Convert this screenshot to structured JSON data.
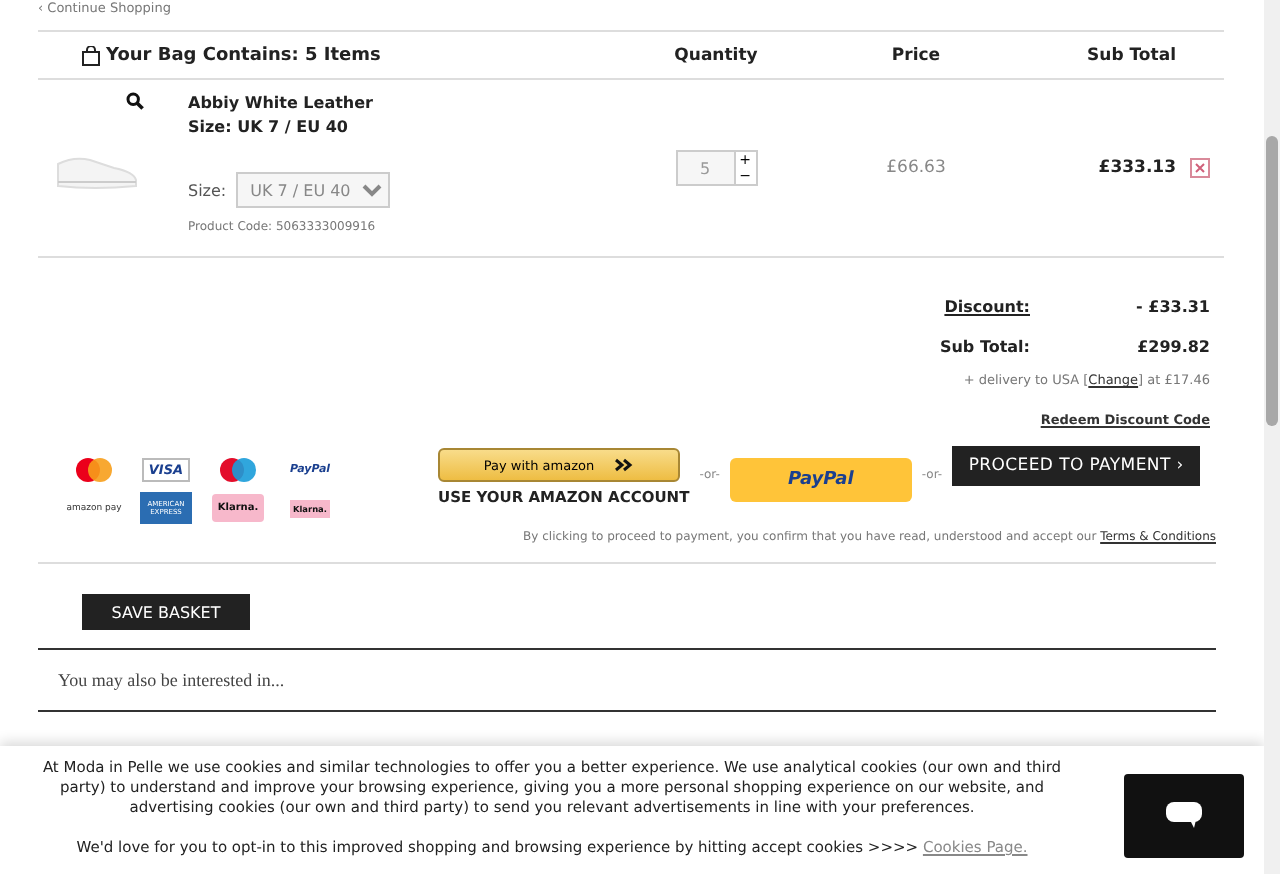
{
  "continue_link": "‹ Continue Shopping",
  "bag": {
    "title": "Your Bag Contains: 5 Items",
    "columns": [
      "Quantity",
      "Price",
      "Sub Total"
    ]
  },
  "items": [
    {
      "name": "Abbiy White Leather",
      "size_text": "Size: UK 7 / EU 40",
      "size_label": "Size:",
      "size_value": "UK 7 / EU 40",
      "product_code": "Product Code: 5063333009916",
      "quantity": "5",
      "plus": "+",
      "minus": "−",
      "price": "£66.63",
      "subtotal": "£333.13"
    }
  ],
  "summary": [
    {
      "label": "Discount:",
      "value": "- £33.31",
      "kind": "link"
    },
    {
      "label": "Sub Total:",
      "value": "£299.82",
      "kind": "plain"
    }
  ],
  "delivery": {
    "before": "+ delivery to USA [",
    "link": "Change",
    "after": "] at £17.46"
  },
  "redeem_link": "Redeem Discount Code",
  "payment_logos": [
    {
      "kind": "mastercard"
    },
    {
      "kind": "visa",
      "label": "VISA"
    },
    {
      "kind": "maestro"
    },
    {
      "kind": "paypal",
      "label": "PayPal"
    },
    {
      "kind": "amazonpay",
      "label": "amazon pay"
    },
    {
      "kind": "amex",
      "label": "AMERICAN EXPRESS"
    },
    {
      "kind": "klarna",
      "label": "Klarna."
    },
    {
      "kind": "klarna-small",
      "label": "Klarna."
    }
  ],
  "amazon_button": {
    "label": "Pay with amazon",
    "caption": "USE YOUR AMAZON ACCOUNT"
  },
  "or_separators": [
    "-or-",
    "-or-"
  ],
  "paypal_button": "PayPal",
  "proceed_button": "PROCEED TO PAYMENT ›",
  "terms": {
    "text": "By clicking to proceed to payment, you confirm that you have read, understood and accept our",
    "link": "Terms & Conditions"
  },
  "save_button": "SAVE BASKET",
  "interested": "You may also be interested in...",
  "cookie_banner": {
    "text": "At Moda in Pelle we use cookies and similar technologies to offer you a better experience. We use analytical cookies (our own and third party) to understand and improve your browsing experience, giving you a more personal shopping experience on our website, and advertising cookies (our own and third party) to send you relevant advertisements in line with your preferences.",
    "optin": "We'd love for you to opt-in to this improved shopping and browsing experience by hitting accept cookies >>>>",
    "link": "Cookies Page."
  }
}
